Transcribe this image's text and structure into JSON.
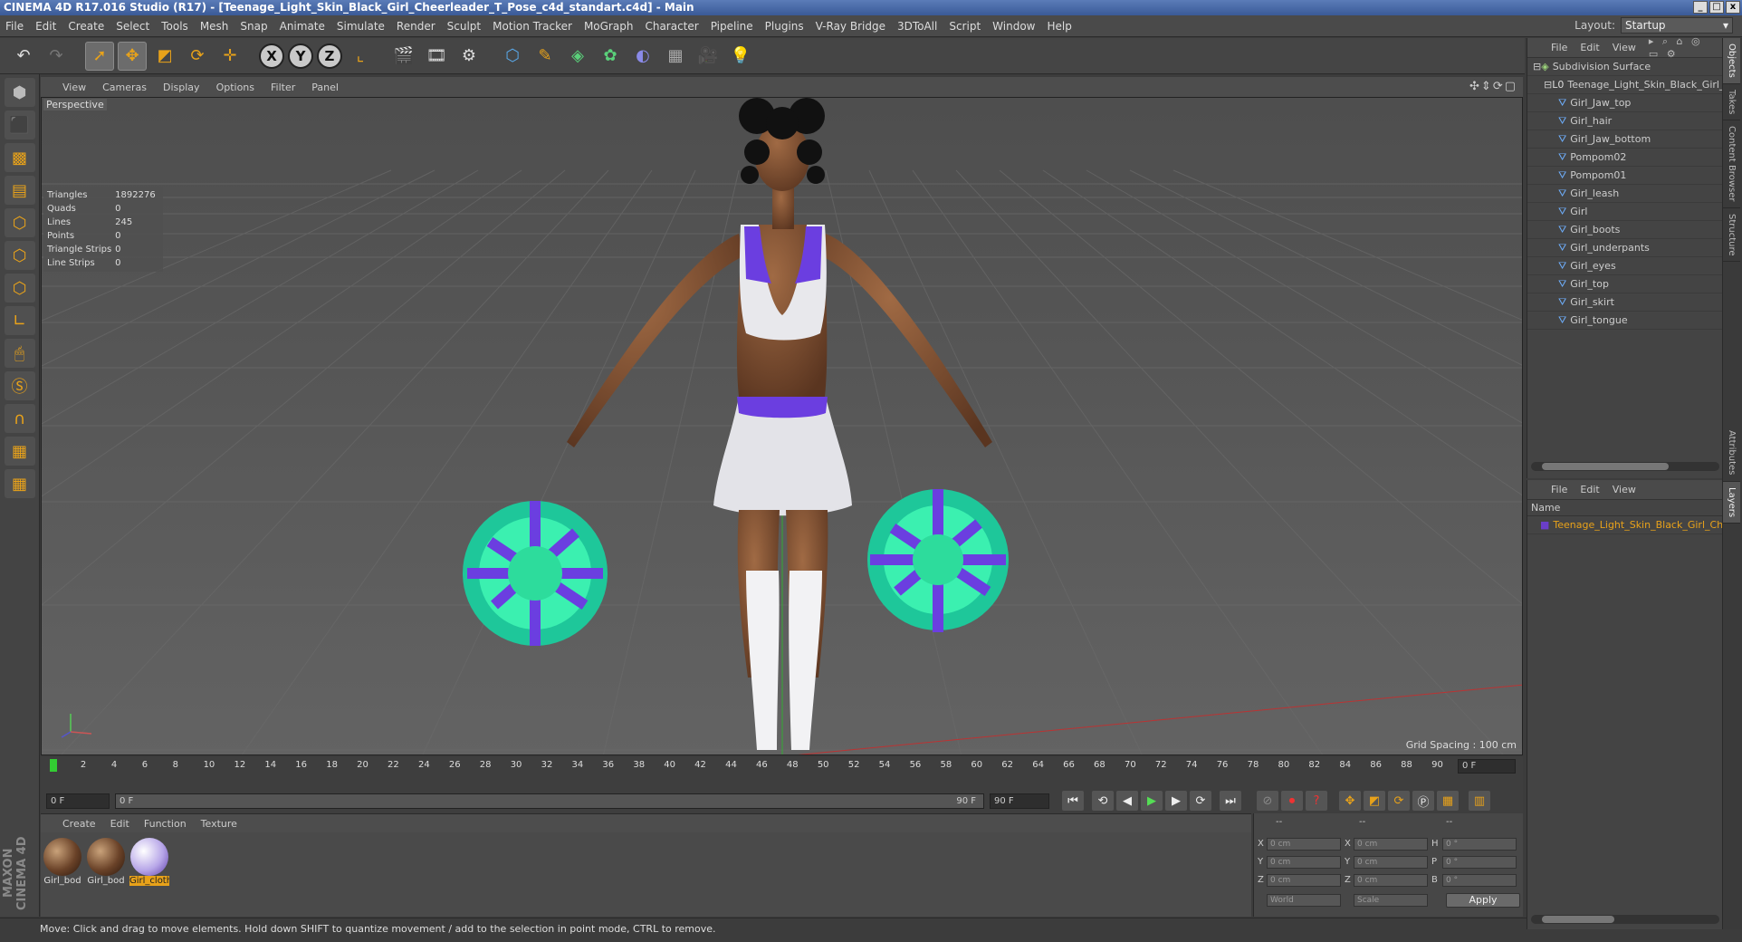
{
  "window": {
    "title": "CINEMA 4D R17.016 Studio (R17) - [Teenage_Light_Skin_Black_Girl_Cheerleader_T_Pose_c4d_standart.c4d] - Main",
    "min": "_",
    "max": "□",
    "close": "x"
  },
  "menu": [
    "File",
    "Edit",
    "Create",
    "Select",
    "Tools",
    "Mesh",
    "Snap",
    "Animate",
    "Simulate",
    "Render",
    "Sculpt",
    "Motion Tracker",
    "MoGraph",
    "Character",
    "Pipeline",
    "Plugins",
    "V-Ray Bridge",
    "3DToAll",
    "Script",
    "Window",
    "Help"
  ],
  "layout": {
    "label": "Layout:",
    "value": "Startup"
  },
  "toolbar": {
    "x_axis": "X",
    "y_axis": "Y",
    "z_axis": "Z"
  },
  "viewport": {
    "menu": [
      "View",
      "Cameras",
      "Display",
      "Options",
      "Filter",
      "Panel"
    ],
    "label": "Perspective",
    "stats": [
      {
        "name": "Triangles",
        "value": "1892276"
      },
      {
        "name": "Quads",
        "value": "0"
      },
      {
        "name": "Lines",
        "value": "245"
      },
      {
        "name": "Points",
        "value": "0"
      },
      {
        "name": "Triangle Strips",
        "value": "0"
      },
      {
        "name": "Line Strips",
        "value": "0"
      }
    ],
    "grid_spacing": "Grid Spacing : 100 cm",
    "nav_icons": "✣⇕⟳▢"
  },
  "timeline": {
    "ticks": [
      "0",
      "2",
      "4",
      "6",
      "8",
      "10",
      "12",
      "14",
      "16",
      "18",
      "20",
      "22",
      "24",
      "26",
      "28",
      "30",
      "32",
      "34",
      "36",
      "38",
      "40",
      "42",
      "44",
      "46",
      "48",
      "50",
      "52",
      "54",
      "56",
      "58",
      "60",
      "62",
      "64",
      "66",
      "68",
      "70",
      "72",
      "74",
      "76",
      "78",
      "80",
      "82",
      "84",
      "86",
      "88",
      "90"
    ],
    "current_frame": "0 F",
    "start": "0 F",
    "range_start": "0 F",
    "range_end": "90 F",
    "end": "90 F"
  },
  "materials": {
    "menu": [
      "Create",
      "Edit",
      "Function",
      "Texture"
    ],
    "items": [
      {
        "label": "Girl_bod"
      },
      {
        "label": "Girl_bod"
      },
      {
        "label": "Girl_cloth"
      }
    ]
  },
  "coords": {
    "headers": [
      "--",
      "--",
      "--"
    ],
    "rows": [
      {
        "axis": "X",
        "pos": "0 cm",
        "axis2": "X",
        "size": "0 cm",
        "axis3": "H",
        "rot": "0 °"
      },
      {
        "axis": "Y",
        "pos": "0 cm",
        "axis2": "Y",
        "size": "0 cm",
        "axis3": "P",
        "rot": "0 °"
      },
      {
        "axis": "Z",
        "pos": "0 cm",
        "axis2": "Z",
        "size": "0 cm",
        "axis3": "B",
        "rot": "0 °"
      }
    ],
    "world": "World",
    "scale": "Scale",
    "apply": "Apply"
  },
  "status": "Move: Click and drag to move elements. Hold down SHIFT to quantize movement / add to the selection in point mode, CTRL to remove.",
  "logo": "MAXON CINEMA 4D",
  "objects": {
    "menu": [
      "File",
      "Edit",
      "View"
    ],
    "root": "Subdivision Surface",
    "group": "Teenage_Light_Skin_Black_Girl_Che",
    "items": [
      "Girl_Jaw_top",
      "Girl_hair",
      "Girl_Jaw_bottom",
      "Pompom02",
      "Pompom01",
      "Girl_leash",
      "Girl",
      "Girl_boots",
      "Girl_underpants",
      "Girl_eyes",
      "Girl_top",
      "Girl_skirt",
      "Girl_tongue"
    ]
  },
  "layers": {
    "menu": [
      "File",
      "Edit",
      "View"
    ],
    "header": "Name",
    "item": "Teenage_Light_Skin_Black_Girl_Che"
  },
  "sidetabs": [
    "Objects",
    "Takes",
    "Content Browser",
    "Structure",
    "Attributes",
    "Layers"
  ]
}
